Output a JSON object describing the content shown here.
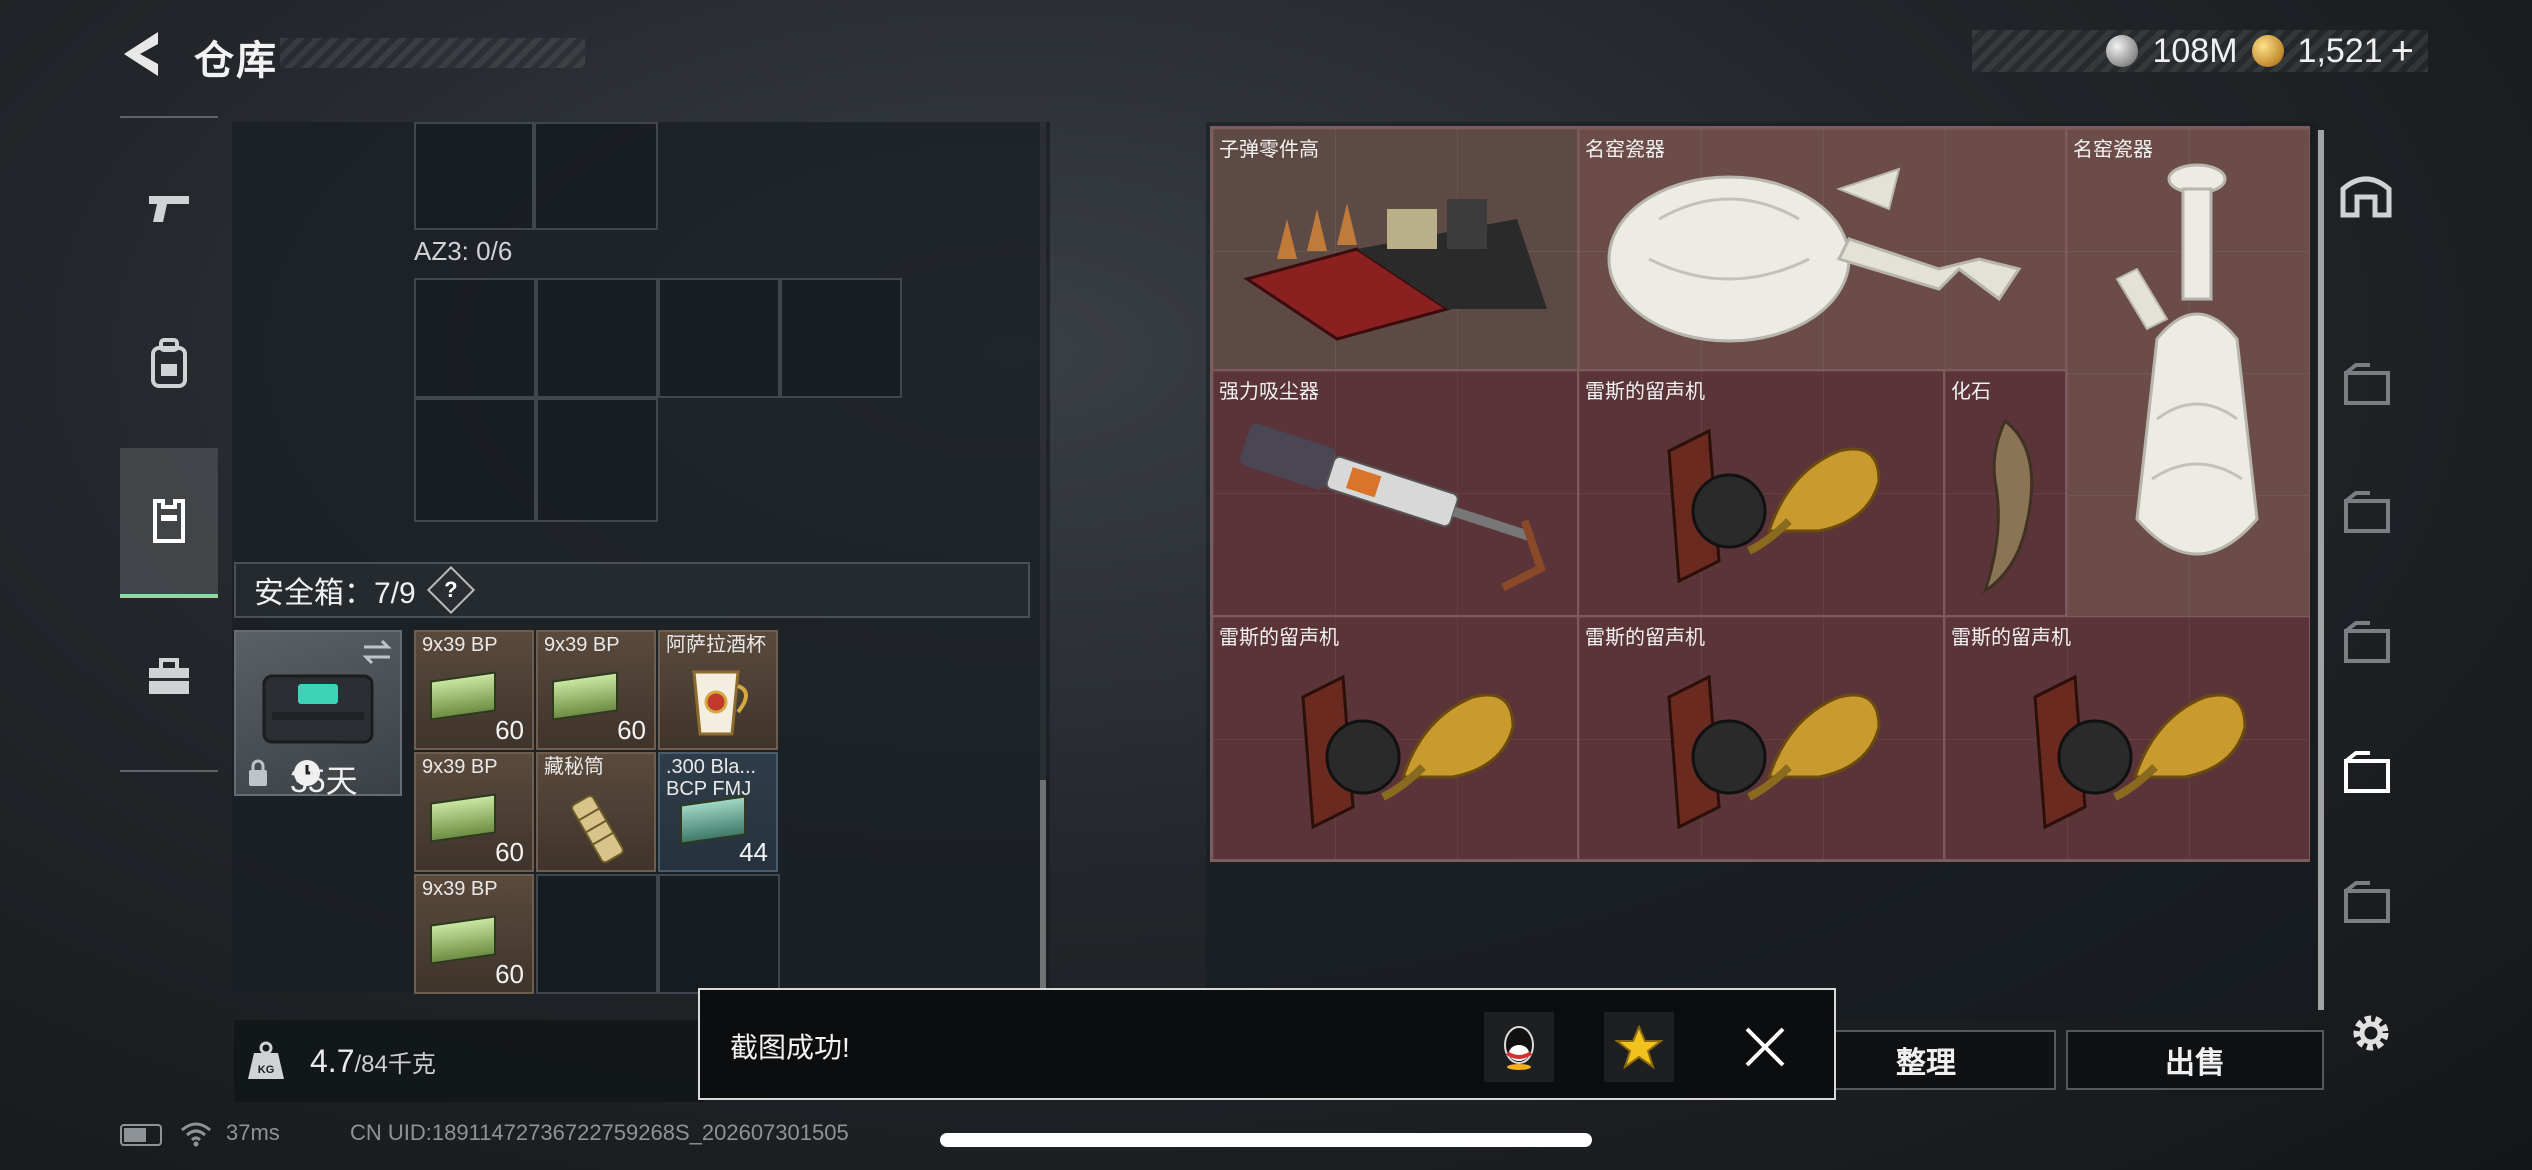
{
  "header": {
    "title": "仓库",
    "currencies": [
      {
        "icon": "silver-coin-icon",
        "value": "108M"
      },
      {
        "icon": "gold-coin-icon",
        "value": "1,521"
      }
    ],
    "add_label": "+"
  },
  "left_nav": [
    {
      "icon": "pistol-icon",
      "active": false
    },
    {
      "icon": "backpack-icon",
      "active": false
    },
    {
      "icon": "vest-icon",
      "active": true
    },
    {
      "icon": "toolbox-icon",
      "active": false
    }
  ],
  "inventory": {
    "az3_label": "AZ3: 0/6",
    "safe_title": "安全箱：7/9",
    "help_label": "?",
    "safe_days": "35天",
    "items": [
      {
        "name": "9x39 BP",
        "count": "60"
      },
      {
        "name": "9x39 BP",
        "count": "60"
      },
      {
        "name": "阿萨拉酒杯",
        "count": ""
      },
      {
        "name": "9x39 BP",
        "count": "60"
      },
      {
        "name": "藏秘筒",
        "count": ""
      },
      {
        "name": ".300 Bla... BCP FMJ",
        "count": "44"
      },
      {
        "name": "9x39 BP",
        "count": "60"
      }
    ],
    "weight_value": "4.7",
    "weight_max": "/84千克"
  },
  "stash": {
    "items": [
      {
        "name": "子弹零件高"
      },
      {
        "name": "名窑瓷器"
      },
      {
        "name": "名窑瓷器"
      },
      {
        "name": "强力吸尘器"
      },
      {
        "name": "雷斯的留声机"
      },
      {
        "name": "化石"
      },
      {
        "name": "雷斯的留声机"
      },
      {
        "name": "雷斯的留声机"
      },
      {
        "name": "雷斯的留声机"
      }
    ]
  },
  "buttons": {
    "organize": "整理",
    "sell": "出售"
  },
  "toast": {
    "message": "截图成功!",
    "share_qq": "qq-icon",
    "share_star": "star-icon"
  },
  "status": {
    "ping": "37ms",
    "uid": "CN UID:18911472736722759268S_202607301505"
  }
}
